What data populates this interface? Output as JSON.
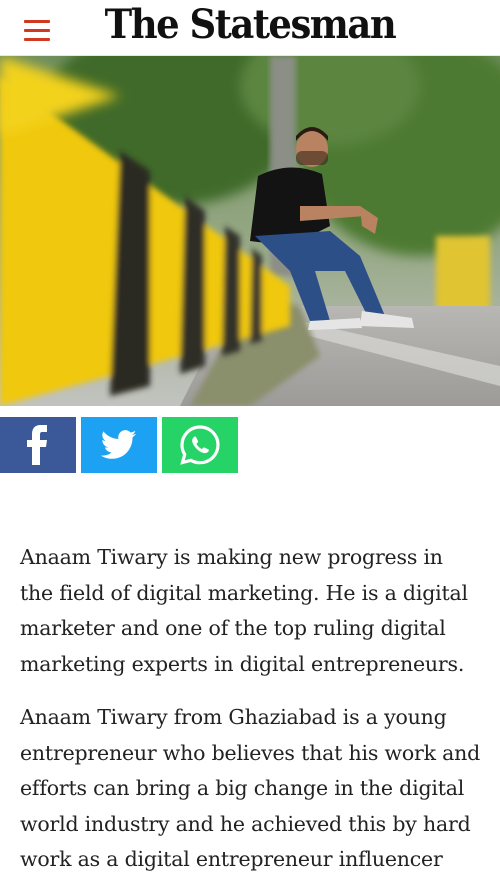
{
  "header": {
    "logo_text": "The Statesman",
    "menu_icon": "hamburger-menu-icon"
  },
  "hero_image": {
    "description_visible": false
  },
  "share": {
    "buttons": [
      {
        "name": "facebook",
        "icon": "facebook-icon",
        "color": "#3b5998"
      },
      {
        "name": "twitter",
        "icon": "twitter-icon",
        "color": "#1da1f2"
      },
      {
        "name": "whatsapp",
        "icon": "whatsapp-icon",
        "color": "#25d366"
      }
    ]
  },
  "article": {
    "paragraphs": [
      "Anaam Tiwary is making new progress in the field of digital marketing. He is a digital marketer and one of the top ruling digital marketing experts in digital entrepreneurs.",
      "Anaam Tiwary from Ghaziabad is a young entrepreneur who believes that his work and efforts can bring a big change in the digital world industry and he achieved this by hard work as a digital entrepreneur influencer"
    ]
  },
  "colors": {
    "menu_accent": "#d0391f",
    "text": "#222222"
  }
}
